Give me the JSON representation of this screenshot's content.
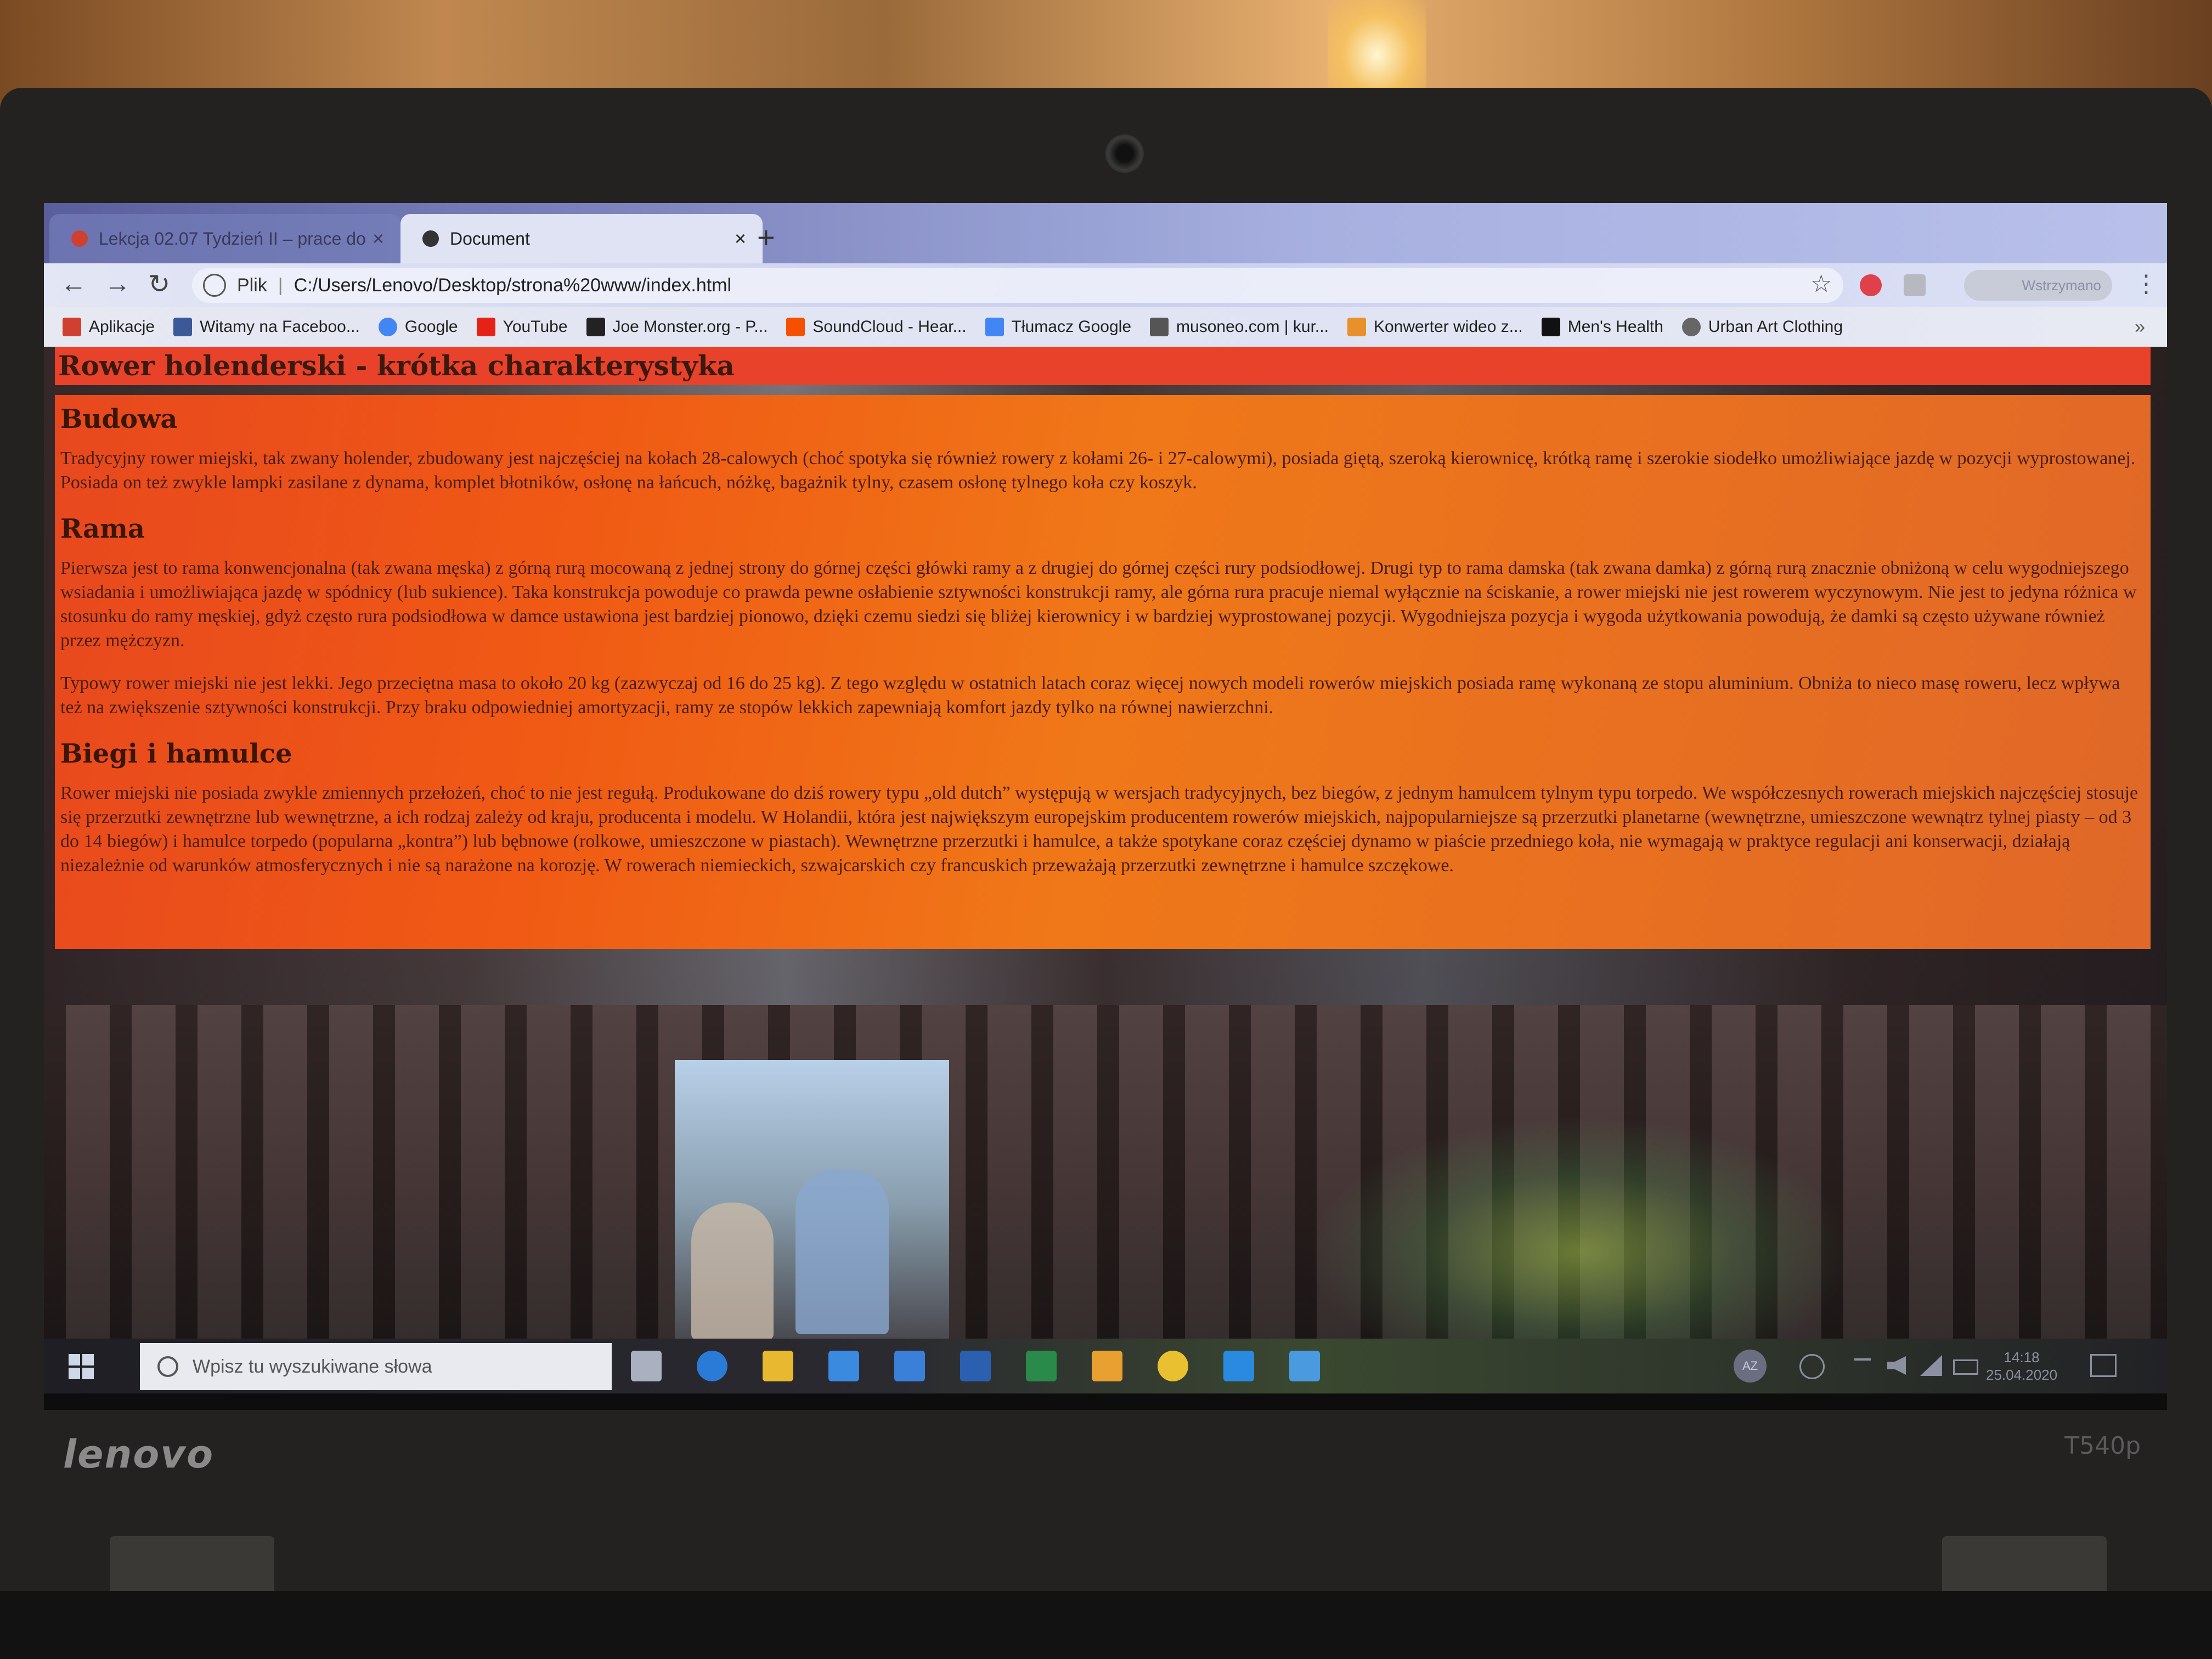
{
  "browser": {
    "tabs": [
      {
        "label": "Lekcja 02.07 Tydzień II – prace do",
        "close": "×"
      },
      {
        "label": "Document",
        "close": "×"
      }
    ],
    "new_tab": "+",
    "nav": {
      "back": "←",
      "forward": "→",
      "reload": "↻"
    },
    "address": {
      "scheme": "Plik",
      "separator": "|",
      "url": "C:/Users/Lenovo/Desktop/strona%20www/index.html"
    },
    "star": "☆",
    "profile_label": "Wstrzymano",
    "menu": "⋮",
    "bookmarks": [
      {
        "label": "Aplikacje",
        "icon": "apps-grid-icon",
        "color": "#d04030"
      },
      {
        "label": "Witamy na Faceboo...",
        "icon": "facebook-icon",
        "color": "#3b5998"
      },
      {
        "label": "Google",
        "icon": "google-icon",
        "color": "#4285f4"
      },
      {
        "label": "YouTube",
        "icon": "youtube-icon",
        "color": "#e62117"
      },
      {
        "label": "Joe Monster.org - P...",
        "icon": "joemonster-icon",
        "color": "#222222"
      },
      {
        "label": "SoundCloud - Hear...",
        "icon": "soundcloud-icon",
        "color": "#f55000"
      },
      {
        "label": "Tłumacz Google",
        "icon": "translate-icon",
        "color": "#4285f4"
      },
      {
        "label": "musoneo.com | kur...",
        "icon": "musoneo-icon",
        "color": "#555555"
      },
      {
        "label": "Konwerter wideo z...",
        "icon": "converter-icon",
        "color": "#e8902a"
      },
      {
        "label": "Men's Health",
        "icon": "menshealth-icon",
        "color": "#111111"
      },
      {
        "label": "Urban Art Clothing",
        "icon": "urbanart-icon",
        "color": "#666666"
      }
    ],
    "bookmarks_more": "»"
  },
  "page": {
    "title": "Rower holenderski - krótka charakterystyka",
    "sections": [
      {
        "heading": "Budowa",
        "paragraphs": [
          "Tradycyjny rower miejski, tak zwany holender, zbudowany jest najczęściej na kołach 28-calowych (choć spotyka się również rowery z kołami 26- i 27-calowymi), posiada giętą, szeroką kierownicę, krótką ramę i szerokie siodełko umożliwiające jazdę w pozycji wyprostowanej. Posiada on też zwykle lampki zasilane z dynama, komplet błotników, osłonę na łańcuch, nóżkę, bagażnik tylny, czasem osłonę tylnego koła czy koszyk."
        ]
      },
      {
        "heading": "Rama",
        "paragraphs": [
          "Pierwsza jest to rama konwencjonalna (tak zwana męska) z górną rurą mocowaną z jednej strony do górnej części główki ramy a z drugiej do górnej części rury podsiodłowej. Drugi typ to rama damska (tak zwana damka) z górną rurą znacznie obniżoną w celu wygodniejszego wsiadania i umożliwiająca jazdę w spódnicy (lub sukience). Taka konstrukcja powoduje co prawda pewne osłabienie sztywności konstrukcji ramy, ale górna rura pracuje niemal wyłącznie na ściskanie, a rower miejski nie jest rowerem wyczynowym. Nie jest to jedyna różnica w stosunku do ramy męskiej, gdyż często rura podsiodłowa w damce ustawiona jest bardziej pionowo, dzięki czemu siedzi się bliżej kierownicy i w bardziej wyprostowanej pozycji. Wygodniejsza pozycja i wygoda użytkowania powodują, że damki są często używane również przez mężczyzn.",
          "Typowy rower miejski nie jest lekki. Jego przeciętna masa to około 20 kg (zazwyczaj od 16 do 25 kg). Z tego względu w ostatnich latach coraz więcej nowych modeli rowerów miejskich posiada ramę wykonaną ze stopu aluminium. Obniża to nieco masę roweru, lecz wpływa też na zwiększenie sztywności konstrukcji. Przy braku odpowiedniej amortyzacji, ramy ze stopów lekkich zapewniają komfort jazdy tylko na równej nawierzchni."
        ]
      },
      {
        "heading": "Biegi i hamulce",
        "paragraphs": [
          "Rower miejski nie posiada zwykle zmiennych przełożeń, choć to nie jest regułą. Produkowane do dziś rowery typu „old dutch” występują w wersjach tradycyjnych, bez biegów, z jednym hamulcem tylnym typu torpedo. We współczesnych rowerach miejskich najczęściej stosuje się przerzutki zewnętrzne lub wewnętrzne, a ich rodzaj zależy od kraju, producenta i modelu. W Holandii, która jest największym europejskim producentem rowerów miejskich, najpopularniejsze są przerzutki planetarne (wewnętrzne, umieszczone wewnątrz tylnej piasty – od 3 do 14 biegów) i hamulce torpedo (popularna „kontra”) lub bębnowe (rolkowe, umieszczone w piastach). Wewnętrzne przerzutki i hamulce, a także spotykane coraz częściej dynamo w piaście przedniego koła, nie wymagają w praktyce regulacji ani konserwacji, działają niezależnie od warunków atmosferycznych i nie są narażone na korozję. W rowerach niemieckich, szwajcarskich czy francuskich przeważają przerzutki zewnętrzne i hamulce szczękowe."
        ]
      }
    ],
    "colors": {
      "title_bg": "#e8422a",
      "content_bg": "#f06a18",
      "text": "#4a1e10"
    }
  },
  "taskbar": {
    "search_placeholder": "Wpisz tu wyszukiwane słowa",
    "apps": [
      {
        "name": "task-view-icon",
        "color": "#aab0c0"
      },
      {
        "name": "edge-icon",
        "color": "#2a7ad8"
      },
      {
        "name": "file-explorer-icon",
        "color": "#e8b830"
      },
      {
        "name": "store-icon",
        "color": "#3a8ae0"
      },
      {
        "name": "mail-icon",
        "color": "#3a80d8"
      },
      {
        "name": "word-icon",
        "color": "#2b5fb0"
      },
      {
        "name": "excel-icon",
        "color": "#2a8a4a"
      },
      {
        "name": "outlook-icon",
        "color": "#e8a030"
      },
      {
        "name": "chrome-icon",
        "color": "#e8c030"
      },
      {
        "name": "vscode-icon",
        "color": "#2a8ae0"
      },
      {
        "name": "photos-icon",
        "color": "#4a9ae0"
      }
    ],
    "tray_user": "AZ",
    "time": "14:18",
    "date": "25.04.2020"
  },
  "laptop": {
    "brand": "lenovo",
    "model": "T540p"
  }
}
